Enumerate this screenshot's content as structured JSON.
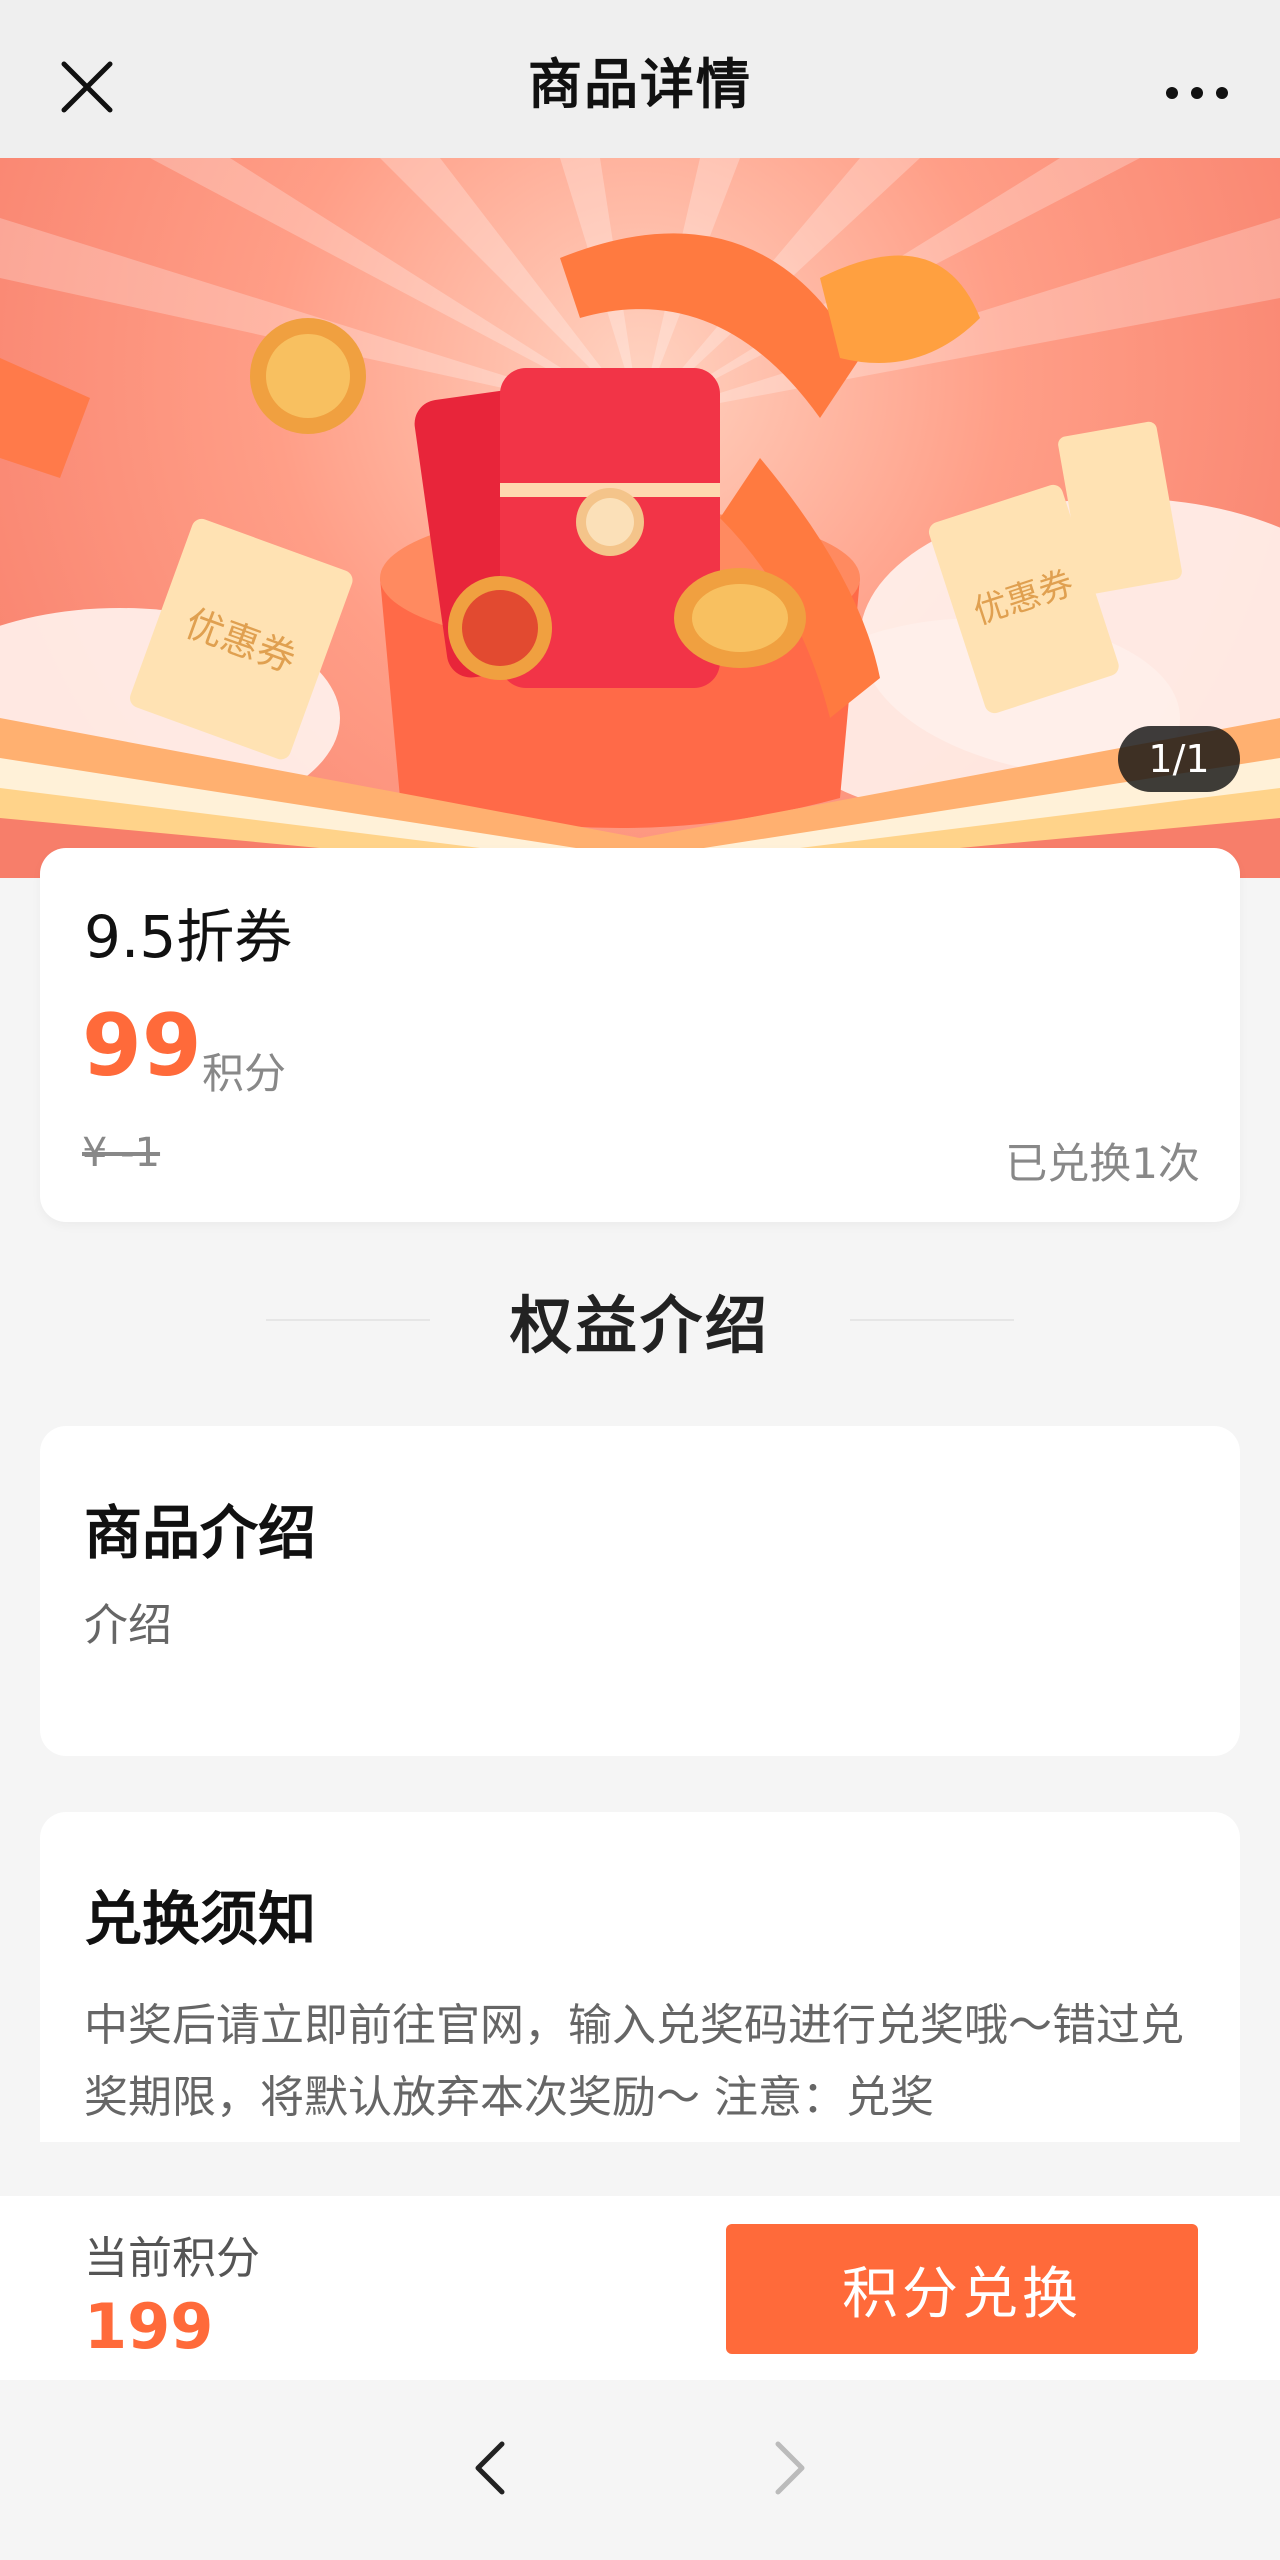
{
  "header": {
    "title": "商品详情"
  },
  "banner": {
    "pager": "1/1",
    "ticket_left": "优惠券",
    "ticket_right": "优惠券"
  },
  "product": {
    "name": "9.5折券",
    "points": "99",
    "points_unit": "积分",
    "original_price": "¥ -1",
    "redeemed": "已兑换1次"
  },
  "section": {
    "title": "权益介绍"
  },
  "intro": {
    "title": "商品介绍",
    "body": "介绍"
  },
  "notice": {
    "title": "兑换须知",
    "body": "中奖后请立即前往官网，输入兑奖码进行兑奖哦～错过兑奖期限，将默认放弃本次奖励～ 注意：兑奖"
  },
  "footer": {
    "points_label": "当前积分",
    "points_value": "199",
    "redeem_button": "积分兑换"
  },
  "colors": {
    "accent": "#ff6a3a",
    "banner": "#f77e6a"
  },
  "icons": {
    "close": "close-icon",
    "more": "more-icon",
    "back": "chevron-left-icon",
    "forward": "chevron-right-icon"
  }
}
